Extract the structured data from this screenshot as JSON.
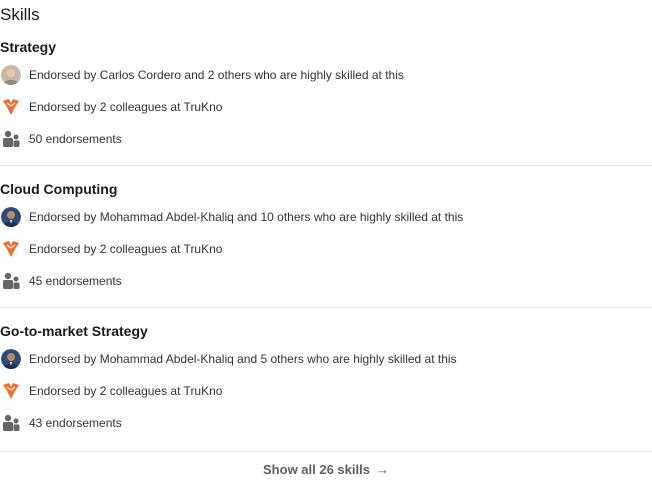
{
  "section": {
    "title": "Skills"
  },
  "skills": [
    {
      "name": "Strategy",
      "endorsed_by_people": "Endorsed by Carlos Cordero and 2 others who are highly skilled at this",
      "endorsed_by_colleagues": "Endorsed by 2 colleagues at TruKno",
      "endorsement_count": "50 endorsements"
    },
    {
      "name": "Cloud Computing",
      "endorsed_by_people": "Endorsed by Mohammad Abdel-Khaliq and 10 others who are highly skilled at this",
      "endorsed_by_colleagues": "Endorsed by 2 colleagues at TruKno",
      "endorsement_count": "45 endorsements"
    },
    {
      "name": "Go-to-market Strategy",
      "endorsed_by_people": "Endorsed by Mohammad Abdel-Khaliq and 5 others who are highly skilled at this",
      "endorsed_by_colleagues": "Endorsed by 2 colleagues at TruKno",
      "endorsement_count": "43 endorsements"
    }
  ],
  "show_all": {
    "label": "Show all 26 skills",
    "arrow": "→"
  },
  "colors": {
    "company_logo": "#f26b2a",
    "people_icon": "#666666",
    "divider": "#e8e8e8"
  },
  "icons": [
    "avatar",
    "trukno-logo-icon",
    "people-icon",
    "arrow-right-icon"
  ]
}
